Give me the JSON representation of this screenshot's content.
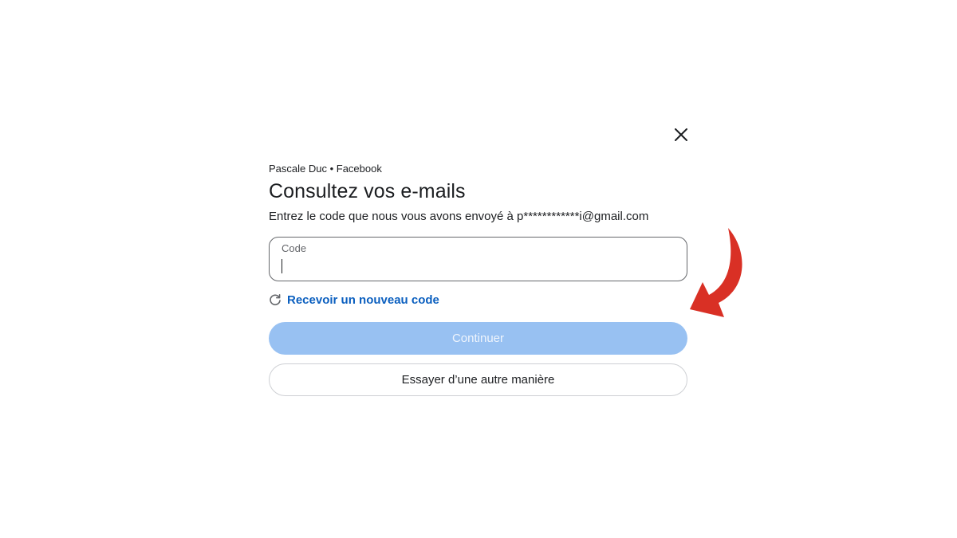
{
  "dialog": {
    "account_line": "Pascale Duc • Facebook",
    "title": "Consultez vos e-mails",
    "subtitle": "Entrez le code que nous vous avons envoyé à p************i@gmail.com",
    "code_field": {
      "label": "Code",
      "value": ""
    },
    "resend_label": "Recevoir un nouveau code",
    "continue_label": "Continuer",
    "other_way_label": "Essayer d’une autre manière"
  },
  "icons": {
    "close": "close-icon",
    "refresh": "refresh-icon",
    "arrow": "red-arrow-annotation"
  },
  "colors": {
    "link": "#0b5fbf",
    "continue_bg": "#98c1f2",
    "arrow": "#d93025",
    "border": "#65676b"
  }
}
